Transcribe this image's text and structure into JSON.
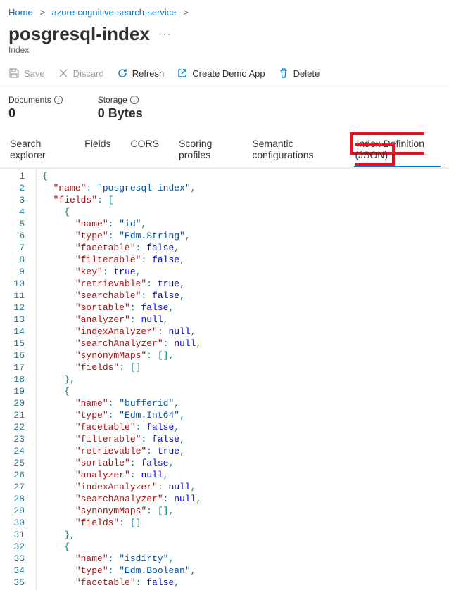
{
  "breadcrumb": {
    "home": "Home",
    "service": "azure-cognitive-search-service"
  },
  "title": "posgresql-index",
  "subtitle": "Index",
  "toolbar": {
    "save": "Save",
    "discard": "Discard",
    "refresh": "Refresh",
    "createDemo": "Create Demo App",
    "delete": "Delete"
  },
  "stats": {
    "documentsLabel": "Documents",
    "documentsValue": "0",
    "storageLabel": "Storage",
    "storageValue": "0 Bytes"
  },
  "tabs": {
    "searchExplorer": "Search explorer",
    "fields": "Fields",
    "cors": "CORS",
    "scoring": "Scoring profiles",
    "semantic": "Semantic configurations",
    "indexDef": "Index Definition (JSON)"
  },
  "code": [
    [
      [
        "p",
        "{"
      ]
    ],
    [
      [
        "p",
        "  "
      ],
      [
        "k",
        "\"name\""
      ],
      [
        "p",
        ": "
      ],
      [
        "s",
        "\"posgresql-index\""
      ],
      [
        "p",
        ","
      ]
    ],
    [
      [
        "p",
        "  "
      ],
      [
        "k",
        "\"fields\""
      ],
      [
        "p",
        ": ["
      ]
    ],
    [
      [
        "p",
        "    {"
      ]
    ],
    [
      [
        "p",
        "      "
      ],
      [
        "k",
        "\"name\""
      ],
      [
        "p",
        ": "
      ],
      [
        "s",
        "\"id\""
      ],
      [
        "p",
        ","
      ]
    ],
    [
      [
        "p",
        "      "
      ],
      [
        "k",
        "\"type\""
      ],
      [
        "p",
        ": "
      ],
      [
        "s",
        "\"Edm.String\""
      ],
      [
        "p",
        ","
      ]
    ],
    [
      [
        "p",
        "      "
      ],
      [
        "k",
        "\"facetable\""
      ],
      [
        "p",
        ": "
      ],
      [
        "cn",
        "false"
      ],
      [
        "p",
        ","
      ]
    ],
    [
      [
        "p",
        "      "
      ],
      [
        "k",
        "\"filterable\""
      ],
      [
        "p",
        ": "
      ],
      [
        "cn",
        "false"
      ],
      [
        "p",
        ","
      ]
    ],
    [
      [
        "p",
        "      "
      ],
      [
        "k",
        "\"key\""
      ],
      [
        "p",
        ": "
      ],
      [
        "cn",
        "true"
      ],
      [
        "p",
        ","
      ]
    ],
    [
      [
        "p",
        "      "
      ],
      [
        "k",
        "\"retrievable\""
      ],
      [
        "p",
        ": "
      ],
      [
        "cn",
        "true"
      ],
      [
        "p",
        ","
      ]
    ],
    [
      [
        "p",
        "      "
      ],
      [
        "k",
        "\"searchable\""
      ],
      [
        "p",
        ": "
      ],
      [
        "cn",
        "false"
      ],
      [
        "p",
        ","
      ]
    ],
    [
      [
        "p",
        "      "
      ],
      [
        "k",
        "\"sortable\""
      ],
      [
        "p",
        ": "
      ],
      [
        "cn",
        "false"
      ],
      [
        "p",
        ","
      ]
    ],
    [
      [
        "p",
        "      "
      ],
      [
        "k",
        "\"analyzer\""
      ],
      [
        "p",
        ": "
      ],
      [
        "cn",
        "null"
      ],
      [
        "p",
        ","
      ]
    ],
    [
      [
        "p",
        "      "
      ],
      [
        "k",
        "\"indexAnalyzer\""
      ],
      [
        "p",
        ": "
      ],
      [
        "cn",
        "null"
      ],
      [
        "p",
        ","
      ]
    ],
    [
      [
        "p",
        "      "
      ],
      [
        "k",
        "\"searchAnalyzer\""
      ],
      [
        "p",
        ": "
      ],
      [
        "cn",
        "null"
      ],
      [
        "p",
        ","
      ]
    ],
    [
      [
        "p",
        "      "
      ],
      [
        "k",
        "\"synonymMaps\""
      ],
      [
        "p",
        ": [],"
      ]
    ],
    [
      [
        "p",
        "      "
      ],
      [
        "k",
        "\"fields\""
      ],
      [
        "p",
        ": []"
      ]
    ],
    [
      [
        "p",
        "    },"
      ]
    ],
    [
      [
        "p",
        "    {"
      ]
    ],
    [
      [
        "p",
        "      "
      ],
      [
        "k",
        "\"name\""
      ],
      [
        "p",
        ": "
      ],
      [
        "s",
        "\"bufferid\""
      ],
      [
        "p",
        ","
      ]
    ],
    [
      [
        "p",
        "      "
      ],
      [
        "k",
        "\"type\""
      ],
      [
        "p",
        ": "
      ],
      [
        "s",
        "\"Edm.Int64\""
      ],
      [
        "p",
        ","
      ]
    ],
    [
      [
        "p",
        "      "
      ],
      [
        "k",
        "\"facetable\""
      ],
      [
        "p",
        ": "
      ],
      [
        "cn",
        "false"
      ],
      [
        "p",
        ","
      ]
    ],
    [
      [
        "p",
        "      "
      ],
      [
        "k",
        "\"filterable\""
      ],
      [
        "p",
        ": "
      ],
      [
        "cn",
        "false"
      ],
      [
        "p",
        ","
      ]
    ],
    [
      [
        "p",
        "      "
      ],
      [
        "k",
        "\"retrievable\""
      ],
      [
        "p",
        ": "
      ],
      [
        "cn",
        "true"
      ],
      [
        "p",
        ","
      ]
    ],
    [
      [
        "p",
        "      "
      ],
      [
        "k",
        "\"sortable\""
      ],
      [
        "p",
        ": "
      ],
      [
        "cn",
        "false"
      ],
      [
        "p",
        ","
      ]
    ],
    [
      [
        "p",
        "      "
      ],
      [
        "k",
        "\"analyzer\""
      ],
      [
        "p",
        ": "
      ],
      [
        "cn",
        "null"
      ],
      [
        "p",
        ","
      ]
    ],
    [
      [
        "p",
        "      "
      ],
      [
        "k",
        "\"indexAnalyzer\""
      ],
      [
        "p",
        ": "
      ],
      [
        "cn",
        "null"
      ],
      [
        "p",
        ","
      ]
    ],
    [
      [
        "p",
        "      "
      ],
      [
        "k",
        "\"searchAnalyzer\""
      ],
      [
        "p",
        ": "
      ],
      [
        "cn",
        "null"
      ],
      [
        "p",
        ","
      ]
    ],
    [
      [
        "p",
        "      "
      ],
      [
        "k",
        "\"synonymMaps\""
      ],
      [
        "p",
        ": [],"
      ]
    ],
    [
      [
        "p",
        "      "
      ],
      [
        "k",
        "\"fields\""
      ],
      [
        "p",
        ": []"
      ]
    ],
    [
      [
        "p",
        "    },"
      ]
    ],
    [
      [
        "p",
        "    {"
      ]
    ],
    [
      [
        "p",
        "      "
      ],
      [
        "k",
        "\"name\""
      ],
      [
        "p",
        ": "
      ],
      [
        "s",
        "\"isdirty\""
      ],
      [
        "p",
        ","
      ]
    ],
    [
      [
        "p",
        "      "
      ],
      [
        "k",
        "\"type\""
      ],
      [
        "p",
        ": "
      ],
      [
        "s",
        "\"Edm.Boolean\""
      ],
      [
        "p",
        ","
      ]
    ],
    [
      [
        "p",
        "      "
      ],
      [
        "k",
        "\"facetable\""
      ],
      [
        "p",
        ": "
      ],
      [
        "cn",
        "false"
      ],
      [
        "p",
        ","
      ]
    ]
  ]
}
